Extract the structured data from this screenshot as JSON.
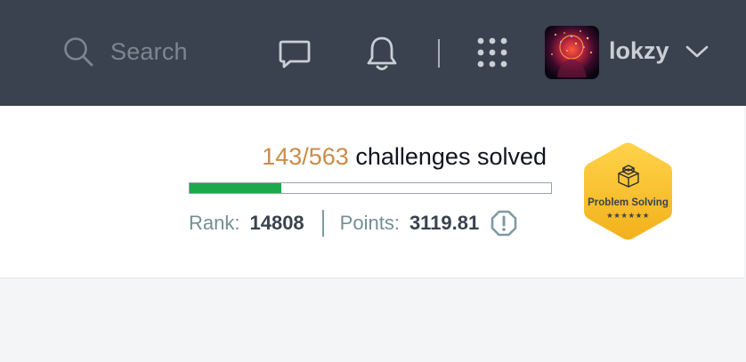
{
  "header": {
    "search": {
      "placeholder": "Search",
      "icon": "search-icon"
    },
    "icons": [
      "chat-icon",
      "bell-icon",
      "apps-grid-icon",
      "chevron-down-icon"
    ],
    "user": {
      "name": "lokzy",
      "avatar": "avatar"
    }
  },
  "profile": {
    "solved_count": "143/563",
    "solved_label": "challenges solved",
    "progress_fraction": 0.254,
    "rank_label": "Rank:",
    "rank_value": "14808",
    "points_label": "Points:",
    "points_value": "3119.81",
    "badge": {
      "title": "Problem Solving",
      "stars": "★★★★★★"
    }
  },
  "colors": {
    "topbar": "#39424e",
    "accent_orange": "#c88d4b",
    "progress_green": "#1ba94c",
    "badge_gold": "#f2c12e"
  }
}
